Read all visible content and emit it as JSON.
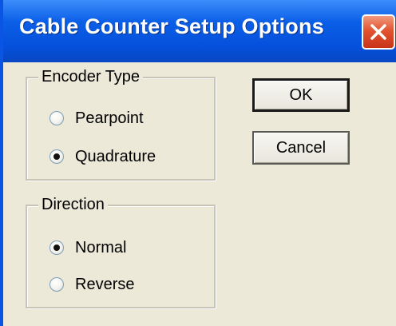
{
  "window": {
    "title": "Cable Counter Setup Options",
    "close_icon": "close-icon"
  },
  "encoder_type": {
    "label": "Encoder Type",
    "options": [
      {
        "label": "Pearpoint",
        "selected": false
      },
      {
        "label": "Quadrature",
        "selected": true
      }
    ]
  },
  "direction": {
    "label": "Direction",
    "options": [
      {
        "label": "Normal",
        "selected": true
      },
      {
        "label": "Reverse",
        "selected": false
      }
    ]
  },
  "buttons": {
    "ok_label": "OK",
    "cancel_label": "Cancel"
  },
  "colors": {
    "titlebar": "#0550dc",
    "dialog_background": "#ece9d8",
    "close_button": "#e2542f"
  }
}
